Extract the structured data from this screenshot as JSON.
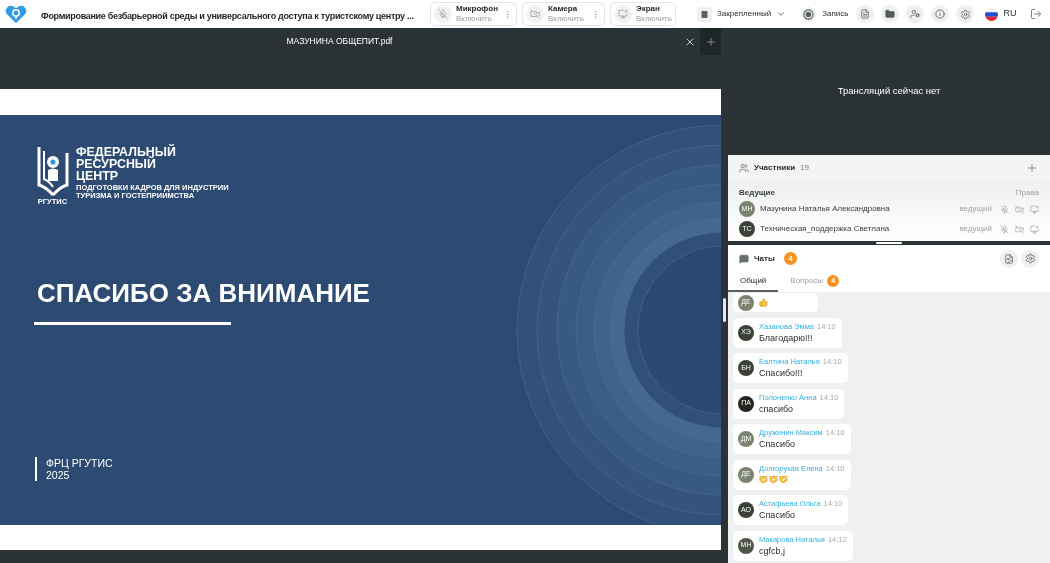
{
  "top_bar": {
    "title": "Формирование безбарьерной среды и универсального доступа к туристскому центру ...",
    "media_buttons": [
      {
        "kind": "microphone",
        "label": "Микрофон",
        "action": "Включить",
        "menu": true
      },
      {
        "kind": "camera",
        "label": "Камера",
        "action": "Включить",
        "menu": true
      },
      {
        "kind": "screen",
        "label": "Экран",
        "action": "Включить",
        "menu": false
      }
    ],
    "layout_select": {
      "value": "Закрепленный"
    },
    "record_button": {
      "label": "Запись"
    },
    "language": {
      "label": "RU"
    }
  },
  "document": {
    "title": "МАЗУНИНА ОБЩЕПИТ.pdf",
    "slide": {
      "logo_title": [
        "ФЕДЕРАЛЬНЫЙ",
        "РЕСУРСНЫЙ",
        "ЦЕНТР"
      ],
      "logo_subtitle": [
        "ПОДГОТОВКИ КАДРОВ ДЛЯ ИНДУСТРИИ",
        "ТУРИЗМА И ГОСТЕПРИИМСТВА"
      ],
      "logo_caption": "РГУТИС",
      "heading": "СПАСИБО ЗА ВНИМАНИЕ",
      "footer_organization": "ФРЦ РГУТИС",
      "footer_year": "2025"
    }
  },
  "broadcast": {
    "message": "Трансляций сейчас нет"
  },
  "participants": {
    "title": "Участники",
    "count": "19",
    "group": {
      "title": "Ведущие",
      "rights_label": "Права",
      "members": [
        {
          "initials": "МН",
          "color": "#7b8270",
          "name": "Мазунина Наталья Александровна",
          "role": "ведущий"
        },
        {
          "initials": "ТС",
          "color": "#3b4136",
          "name": "Техническая_поддержка Светлана",
          "role": "ведущий"
        }
      ]
    }
  },
  "chat": {
    "title": "Чаты",
    "badge": "4",
    "tabs": [
      {
        "label": "Общий",
        "selected": true
      },
      {
        "label": "Вопросы",
        "selected": false,
        "badge": "4"
      }
    ],
    "messages": [
      {
        "kind": "thumbs_up",
        "initials": "ДЕ",
        "color": "#7b8270"
      },
      {
        "kind": "text",
        "initials": "ХЭ",
        "color": "#3b4136",
        "author": "Хазанова Эмма",
        "time": "14:10",
        "text": "Благодарю!!!"
      },
      {
        "kind": "text",
        "initials": "БН",
        "color": "#3b4136",
        "author": "Балтина Наталья",
        "time": "14:10",
        "text": "Спасибо!!!"
      },
      {
        "kind": "text",
        "initials": "ПА",
        "color": "#24271f",
        "author": "Полоненко Анна",
        "time": "14:10",
        "text": "спасибо"
      },
      {
        "kind": "text",
        "initials": "ДМ",
        "color": "#7b8270",
        "author": "Дружинин Максим",
        "time": "14:10",
        "text": "Спасибо"
      },
      {
        "kind": "handshakes",
        "initials": "ДЕ",
        "color": "#7b8270",
        "author": "Долгорукая Елена",
        "time": "14:10"
      },
      {
        "kind": "text",
        "initials": "АО",
        "color": "#3b4136",
        "author": "Астафьева Ольга",
        "time": "14:10",
        "text": "Спасибо"
      },
      {
        "kind": "text",
        "initials": "МН",
        "color": "#4f5647",
        "author": "Макарова Наталья",
        "time": "14:12",
        "text": "cgfcb,j"
      }
    ]
  }
}
